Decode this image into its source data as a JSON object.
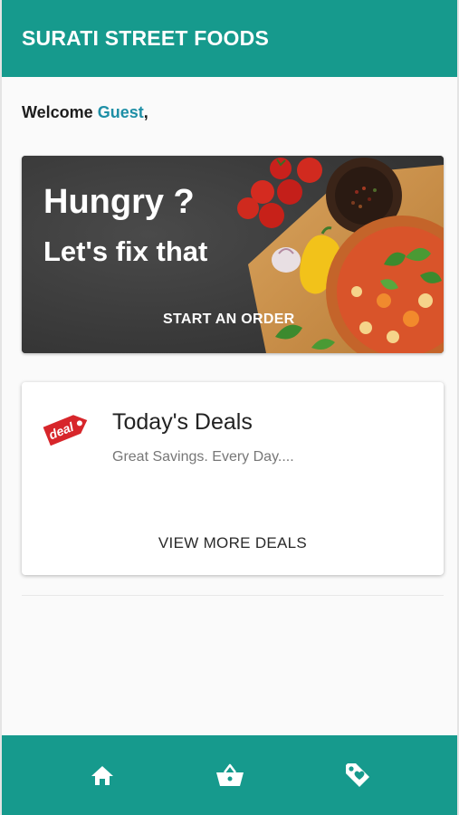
{
  "app_bar": {
    "title": "SURATI STREET FOODS"
  },
  "welcome": {
    "prefix": "Welcome ",
    "user": "Guest",
    "suffix": ","
  },
  "hero": {
    "title": "Hungry ?",
    "subtitle": "Let's fix that",
    "cta_label": "START AN ORDER"
  },
  "deals": {
    "badge_text": "deal",
    "title": "Today's Deals",
    "subtitle": "Great Savings. Every Day....",
    "action_label": "VIEW MORE DEALS"
  },
  "bottom_nav": {
    "items": [
      {
        "icon": "home-icon"
      },
      {
        "icon": "basket-icon"
      },
      {
        "icon": "tag-icon"
      }
    ]
  },
  "colors": {
    "primary": "#169a8d",
    "accent_text": "#1e8fa6",
    "deal_red": "#d7262b"
  }
}
